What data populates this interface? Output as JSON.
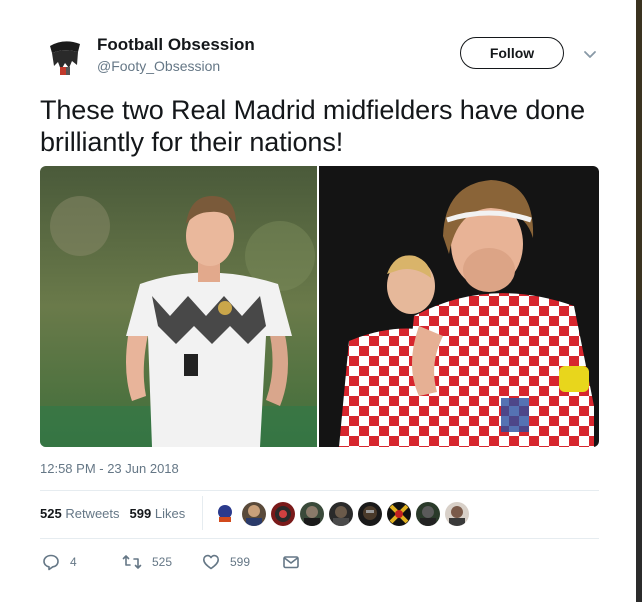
{
  "user": {
    "display_name": "Football Obsession",
    "handle": "@Footy_Obsession"
  },
  "follow_label": "Follow",
  "tweet": {
    "text": "These two Real Madrid midfielders have done brilliantly for their nations!",
    "timestamp": "12:58 PM - 23 Jun 2018"
  },
  "stats": {
    "retweets_count": "525",
    "retweets_label": "Retweets",
    "likes_count": "599",
    "likes_label": "Likes"
  },
  "actions": {
    "reply_count": "4",
    "retweet_count": "525",
    "like_count": "599"
  },
  "icons": {
    "reply": "reply-icon",
    "retweet": "retweet-icon",
    "like": "heart-icon",
    "dm": "envelope-icon",
    "more": "chevron-down-icon"
  },
  "colors": {
    "text": "#14171a",
    "secondary": "#657786",
    "divider": "#e6ecf0"
  }
}
